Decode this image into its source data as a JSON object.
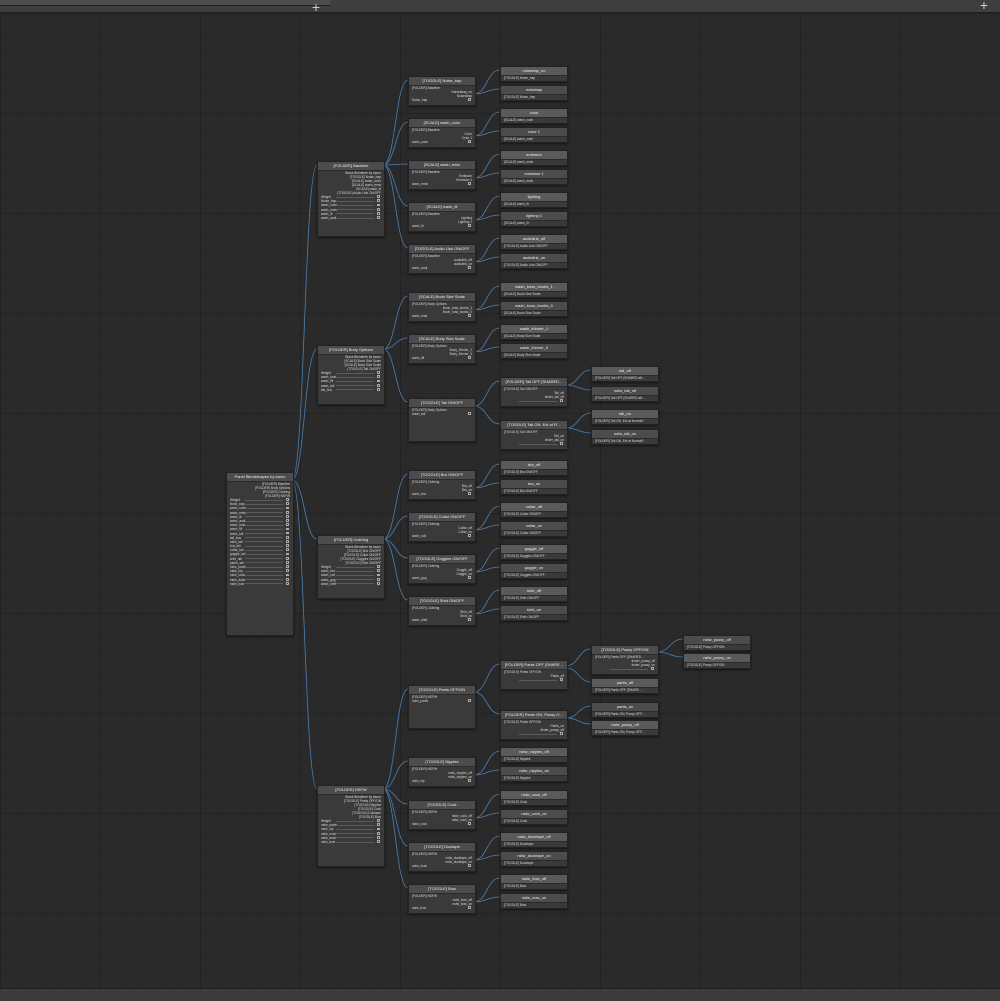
{
  "toolbar": {
    "add_tab_icon": "plus-icon",
    "add_node_icon": "plus-icon"
  },
  "wire_color": "#4b7fb3",
  "root": {
    "title": "Panel Blendshapes by kaoru",
    "sub": [
      "[FOLDER] Baseline",
      "[FOLDER] Body Options",
      "[FOLDER] Clothing",
      "[FOLDER] NSFW"
    ],
    "rows": [
      "Weight",
      "Nose_bap",
      "wash_color",
      "wash_emis",
      "wash_lit",
      "wash_audi",
      "wash_bust",
      "wash_fill",
      "wash_tail",
      "tail_bus",
      "nsfw_tail",
      "bra_tail",
      "collar_tail",
      "goggle_tail",
      "shirt_tail",
      "pants_tail",
      "nsfw_pants",
      "nsfw_nip",
      "nsfw_cock",
      "nsfw_duck",
      "nsfw_bow"
    ]
  },
  "folders": [
    {
      "title": "[FOLDER] Baseline",
      "sub": [
        "Blank Blendtree by kaoru",
        "[TOGGLE] Noise_bap",
        "[SCALE] wash_color",
        "[SCALE] wash_emis",
        "[SCALE] wash_lit",
        "[TOGGLE] Audio Link ON/OFF"
      ],
      "rows": [
        "Weight",
        "Noise_bap",
        "wash_color",
        "wash_emis",
        "wash_lit",
        "wash_audi"
      ]
    },
    {
      "title": "[FOLDER] Body Options",
      "sub": [
        "Blank Blendtree by kaoru",
        "[SCALE] Boob Size Scale",
        "[SCALE] Body Size Scale",
        "[TOGGLE] Tail ON/OFF"
      ],
      "rows": [
        "Weight",
        "wash_bust",
        "wash_fill",
        "wash_tail",
        "tail_bus"
      ]
    },
    {
      "title": "[FOLDER] Clothing",
      "sub": [
        "Blank Blendtree by kaoru",
        "[TOGGLE] Bra ON/OFF",
        "[TOGGLE] Collar ON/OFF",
        "[TOGGLE] Goggles ON/OFF",
        "[TOGGLE] Shirt ON/OFF"
      ],
      "rows": [
        "Weight",
        "wash_bra",
        "wash_coll",
        "wash_gog",
        "wash_shirt"
      ]
    },
    {
      "title": "[FOLDER] NSFW",
      "sub": [
        "Blank Blendtree by kaoru",
        "[TOGGLE] Pants OFF/ON",
        "[TOGGLE] Nipples",
        "[TOGGLE] Cock",
        "[TOGGLE] Duckape",
        "[TOGGLE] Bow"
      ],
      "rows": [
        "Weight",
        "nsfw_pants",
        "nsfw_nip",
        "nsfw_cock",
        "nsfw_duck",
        "nsfw_bow"
      ]
    }
  ],
  "toggles": [
    {
      "title": "[TOGGLE] Noise_bap",
      "sub": "[FOLDER] Baseline",
      "outs": [
        "Noiseabap_no",
        "Noiseabap"
      ],
      "param": "Noise_bap"
    },
    {
      "title": "[SCALE] wash_color",
      "sub": "[FOLDER] Baseline",
      "outs": [
        "Color",
        "Color 1"
      ],
      "param": "wash_color"
    },
    {
      "title": "[SCALE] wash_emis",
      "sub": "[FOLDER] Baseline",
      "outs": [
        "Emission",
        "Emission 1"
      ],
      "param": "wash_emis"
    },
    {
      "title": "[SCALE] wash_lit",
      "sub": "[FOLDER] Baseline",
      "outs": [
        "Lighting",
        "Lighting 1"
      ],
      "param": "wash_lit"
    },
    {
      "title": "[TOGGLE] Audio Link ON/OFF",
      "sub": "[FOLDER] Baseline",
      "outs": [
        "audiolink_off",
        "audiolink_on"
      ],
      "param": "wash_audi"
    },
    {
      "title": "[SCALE] Boob Size Scale",
      "sub": "[FOLDER] Body Options",
      "outs": [
        "Boob_bust_boobs_1",
        "Boob_bust_boobs_0"
      ],
      "param": "wash_bust"
    },
    {
      "title": "[SCALE] Body Size Scale",
      "sub": "[FOLDER] Body Options",
      "outs": [
        "Body_thinner_1",
        "Body_thinner_0"
      ],
      "param": "wash_fill"
    },
    {
      "title": "[TOGGLE] Tail ON/OFF",
      "sub": "[FOLDER] Body Options",
      "outs": [],
      "param": "wash_tail"
    },
    {
      "title": "[TOGGLE] Bra ON/OFF",
      "sub": "[FOLDER] Clothing",
      "outs": [
        "Bra_off",
        "Bra_on"
      ],
      "param": "wash_bra"
    },
    {
      "title": "[TOGGLE] Collar ON/OFF",
      "sub": "[FOLDER] Clothing",
      "outs": [
        "Collar_off",
        "Collar_on"
      ],
      "param": "wash_coll"
    },
    {
      "title": "[TOGGLE] Goggles ON/OFF",
      "sub": "[FOLDER] Clothing",
      "outs": [
        "Goggle_off",
        "Goggle_on"
      ],
      "param": "wash_gog"
    },
    {
      "title": "[TOGGLE] Shirt ON/OFF",
      "sub": "[FOLDER] Clothing",
      "outs": [
        "Shirt_off",
        "Shirt_on"
      ],
      "param": "wash_shirt"
    },
    {
      "title": "[TOGGLE] Pants OFF/ON",
      "sub": "[FOLDER] NSFW",
      "outs": [],
      "param": "nsfw_pants"
    },
    {
      "title": "[TOGGLE] Nipples",
      "sub": "[FOLDER] NSFW",
      "outs": [
        "nsfw_nipples_off",
        "nsfw_nipples_on"
      ],
      "param": "nsfw_nip"
    },
    {
      "title": "[TOGGLE] Cock",
      "sub": "[FOLDER] NSFW",
      "outs": [
        "nsfw_cock_off",
        "nsfw_cock_on"
      ],
      "param": "nsfw_cock"
    },
    {
      "title": "[TOGGLE] Duckape",
      "sub": "[FOLDER] NSFW",
      "outs": [
        "nsfw_ducktape_off",
        "nsfw_ducktape_on"
      ],
      "param": "nsfw_duck"
    },
    {
      "title": "[TOGGLE] Bow",
      "sub": "[FOLDER] NSFW",
      "outs": [
        "nsfw_bow_off",
        "nsfw_bow_on"
      ],
      "param": "nsfw_bow"
    }
  ],
  "clips": [
    {
      "title": "noisebap_no",
      "sub": "[TOGGLE] Noise_bap"
    },
    {
      "title": "noisebap",
      "sub": "[TOGGLE] Noise_bap"
    },
    {
      "title": "color",
      "sub": "[SCALE] wash_color"
    },
    {
      "title": "color 1",
      "sub": "[SCALE] wash_color"
    },
    {
      "title": "emission",
      "sub": "[SCALE] wash_emis"
    },
    {
      "title": "emission 1",
      "sub": "[SCALE] wash_emis"
    },
    {
      "title": "lighting",
      "sub": "[SCALE] wash_lit"
    },
    {
      "title": "lighting 1",
      "sub": "[SCALE] wash_lit"
    },
    {
      "title": "audiolink_off",
      "sub": "[TOGGLE] Audio Link ON/OFF"
    },
    {
      "title": "audiolink_on",
      "sub": "[TOGGLE] Audio Link ON/OFF"
    },
    {
      "title": "wash_boss_boobs_1",
      "sub": "[SCALE] Boob Size Scale"
    },
    {
      "title": "wash_boss_boobs_0",
      "sub": "[SCALE] Boob Size Scale"
    },
    {
      "title": "wash_thinner_1",
      "sub": "[SCALE] Body Size Scale"
    },
    {
      "title": "wash_thinner_0",
      "sub": "[SCALE] Body Size Scale"
    },
    {
      "title": "bra_off",
      "sub": "[TOGGLE] Bra ON/OFF"
    },
    {
      "title": "bra_on",
      "sub": "[TOGGLE] Bra ON/OFF"
    },
    {
      "title": "collar_off",
      "sub": "[TOGGLE] Collar ON/OFF"
    },
    {
      "title": "collar_on",
      "sub": "[TOGGLE] Collar ON/OFF"
    },
    {
      "title": "goggle_off",
      "sub": "[TOGGLE] Goggles ON/OFF"
    },
    {
      "title": "goggle_on",
      "sub": "[TOGGLE] Goggles ON/OFF"
    },
    {
      "title": "shirt_off",
      "sub": "[TOGGLE] Shirt ON/OFF"
    },
    {
      "title": "shirt_on",
      "sub": "[TOGGLE] Shirt ON/OFF"
    },
    {
      "title": "nsfw_nipples_off",
      "sub": "[TOGGLE] Nipples"
    },
    {
      "title": "nsfw_nipples_on",
      "sub": "[TOGGLE] Nipples"
    },
    {
      "title": "nsfw_cock_off",
      "sub": "[TOGGLE] Cock"
    },
    {
      "title": "nsfw_cock_on",
      "sub": "[TOGGLE] Cock"
    },
    {
      "title": "nsfw_ducktape_off",
      "sub": "[TOGGLE] Ducktape"
    },
    {
      "title": "nsfw_ducktape_on",
      "sub": "[TOGGLE] Ducktape"
    },
    {
      "title": "nsfw_bow_off",
      "sub": "[TOGGLE] Bow"
    },
    {
      "title": "nsfw_bow_on",
      "sub": "[TOGGLE] Bow"
    }
  ],
  "subtrees": [
    {
      "title": "[FOLDER] Tail OFF [SHARED...",
      "sub": "[TOGGLE] Tail ON/OFF",
      "outs": [
        "Tail_off",
        "tinder_tail_off"
      ]
    },
    {
      "title": "[TOGGLE] Tail ON, Ext at Fl...",
      "sub": "[TOGGLE] Tail ON/OFF",
      "outs": [
        "Tail_on",
        "tinder_tail_on"
      ]
    },
    {
      "title": "[FOLDER] Pants OFF [SHARE...",
      "sub": "[TOGGLE] Pants OFF/ON",
      "outs": [
        "Pants_off"
      ]
    },
    {
      "title": "[FOLDER] Pants ON, Pussy O...",
      "sub": "[TOGGLE] Pants OFF/ON",
      "outs": [
        "Pants_on",
        "tinder_pussy_off"
      ]
    },
    {
      "title": "[TOGGLE] Pussy OFF/ON",
      "sub": "[FOLDER] Pants OFF [SHARED...",
      "outs": [
        "tinder_pussy_off",
        "tinder_pussy_on"
      ]
    }
  ],
  "leaf2": [
    {
      "title": "tail_off",
      "sub": "[FOLDER] Tail OFF [SHARED aft..."
    },
    {
      "title": "nsfw_tail_off",
      "sub": "[FOLDER] Tail OFF [SHARED aft..."
    },
    {
      "title": "tail_on",
      "sub": "[FOLDER] Tail ON, Ext at Normal?"
    },
    {
      "title": "nsfw_tail_on",
      "sub": "[FOLDER] Tail ON, Ext at Normal?"
    },
    {
      "title": "pants_off",
      "sub": "[FOLDER] Pants OFF [SHARE..."
    },
    {
      "title": "pants_on",
      "sub": "[FOLDER] Pants ON, Pussy OFF..."
    },
    {
      "title": "nsfw_pussy_off",
      "sub": "[FOLDER] Pants ON, Pussy OFF..."
    },
    {
      "title": "nsfw_pussy_off",
      "sub": "[TOGGLE] Pussy OFF/ON"
    },
    {
      "title": "nsfw_pussy_on",
      "sub": "[TOGGLE] Pussy OFF/ON"
    }
  ]
}
